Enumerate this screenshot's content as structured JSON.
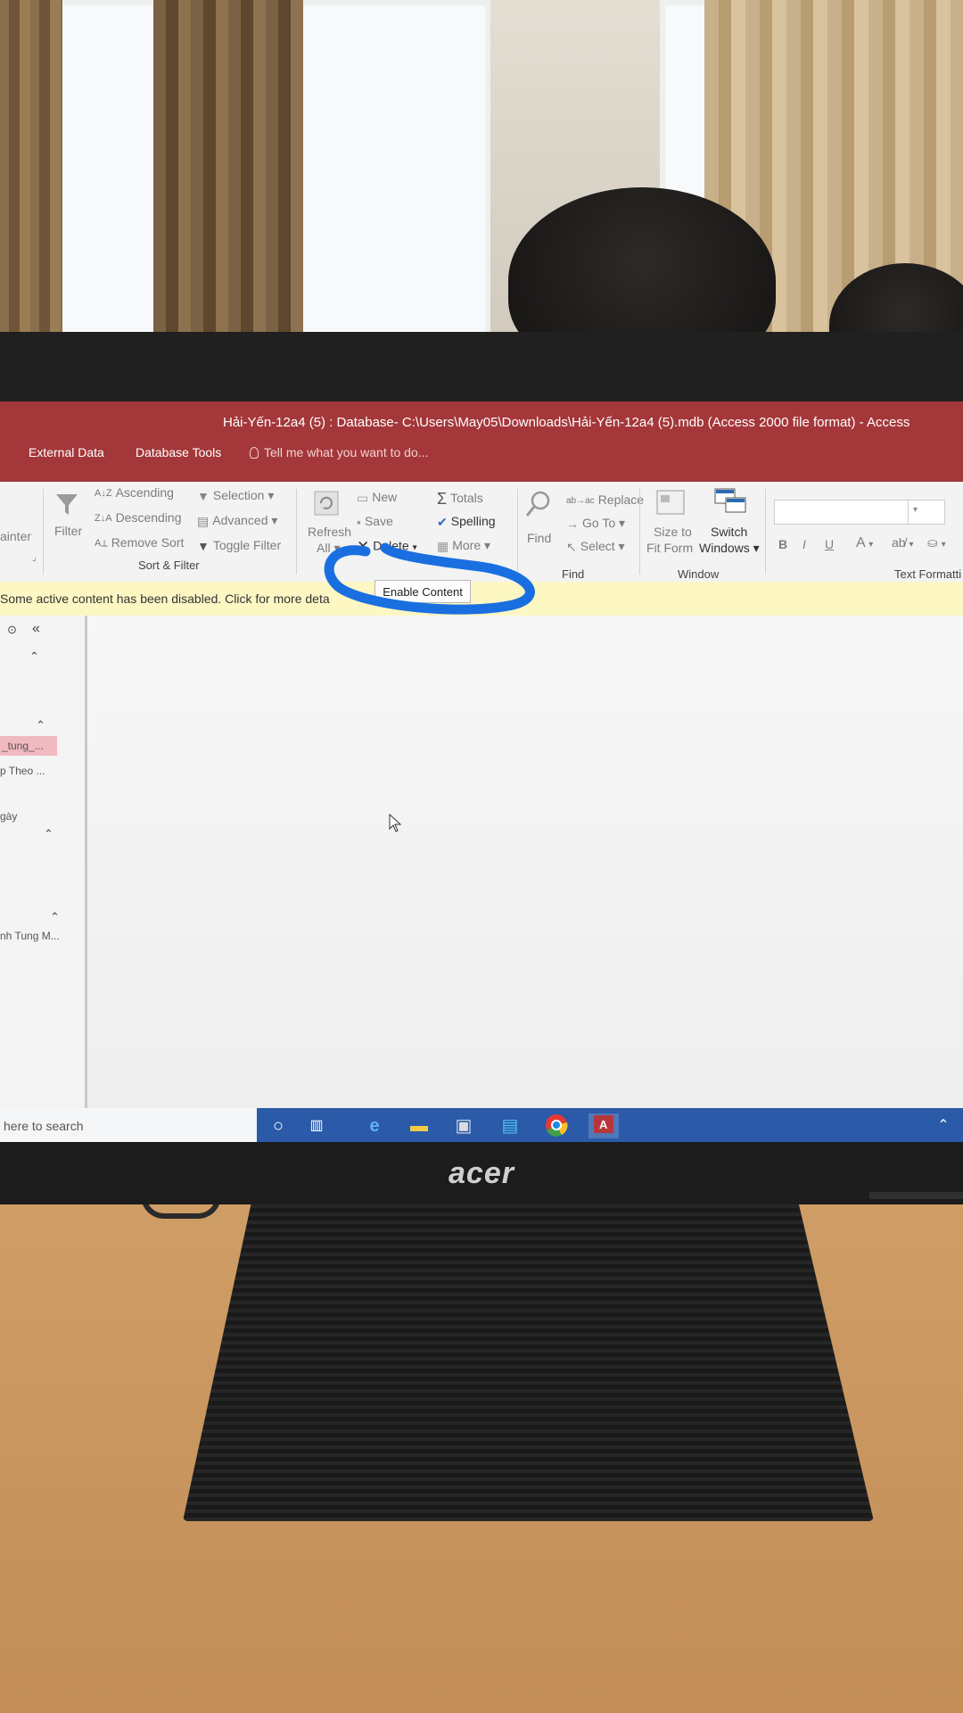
{
  "window": {
    "title": "Hải-Yến-12a4 (5) : Database- C:\\Users\\May05\\Downloads\\Hải-Yến-12a4 (5).mdb (Access 2000 file format) - Access",
    "tabs": [
      "External Data",
      "Database Tools"
    ],
    "tell_me": "Tell me what you want to do..."
  },
  "ribbon": {
    "painter": "ainter",
    "filter": "Filter",
    "ascending": "Ascending",
    "descending": "Descending",
    "remove_sort": "Remove Sort",
    "selection": "Selection",
    "advanced": "Advanced",
    "toggle_filter": "Toggle Filter",
    "sort_filter_group": "Sort & Filter",
    "refresh_line1": "Refresh",
    "refresh_line2": "All",
    "new": "New",
    "save": "Save",
    "delete": "Delete",
    "totals": "Totals",
    "spelling": "Spelling",
    "more": "More",
    "find": "Find",
    "replace": "Replace",
    "go_to": "Go To",
    "select": "Select",
    "find_group": "Find",
    "size_to_fit_line1": "Size to",
    "size_to_fit_line2": "Fit Form",
    "switch_windows_line1": "Switch",
    "switch_windows_line2": "Windows",
    "window_group": "Window",
    "bold": "B",
    "italic": "I",
    "underline": "U",
    "font_color": "A",
    "text_formatting_group": "Text Formatti"
  },
  "message_bar": {
    "text": "Some active content has been disabled. Click for more deta",
    "enable_button": "Enable Content"
  },
  "nav_pane": {
    "items": [
      "_tung_...",
      "p Theo ...",
      "gày",
      "nh Tung M..."
    ]
  },
  "taskbar": {
    "search_placeholder": "here to search"
  },
  "monitor": {
    "brand": "acer"
  },
  "colors": {
    "title_bar": "#a4373a",
    "message_bar": "#fdf7c4",
    "taskbar": "#2a5aa8",
    "annotation": "#1a6fe0"
  }
}
